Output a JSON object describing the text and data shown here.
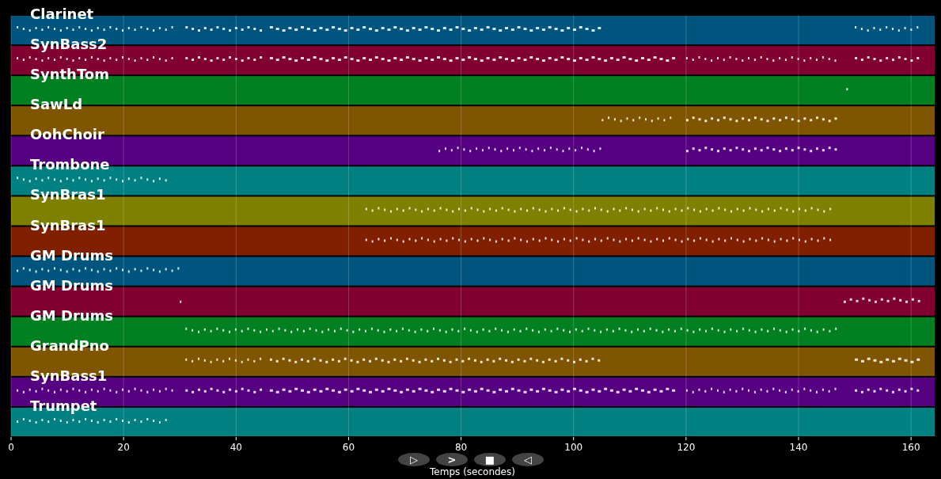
{
  "tracks": [
    {
      "name": "Clarinet",
      "color": "#00557f"
    },
    {
      "name": "SynBass2",
      "color": "#800030"
    },
    {
      "name": "SynthTom",
      "color": "#008020"
    },
    {
      "name": "SawLd",
      "color": "#805500"
    },
    {
      "name": "OohChoir",
      "color": "#550080"
    },
    {
      "name": "Trombone",
      "color": "#008080"
    },
    {
      "name": "SynBras1",
      "color": "#808000"
    },
    {
      "name": "SynBras1",
      "color": "#802000"
    },
    {
      "name": "GM Drums",
      "color": "#00557f"
    },
    {
      "name": "GM Drums",
      "color": "#800030"
    },
    {
      "name": "GM Drums",
      "color": "#008020"
    },
    {
      "name": "GrandPno",
      "color": "#805500"
    },
    {
      "name": "SynBass1",
      "color": "#550080"
    },
    {
      "name": "Trumpet",
      "color": "#008080"
    }
  ],
  "x_axis": {
    "ticks": [
      "0",
      "20",
      "40",
      "60",
      "80",
      "100",
      "120",
      "140",
      "160"
    ],
    "label": "Temps (secondes)"
  },
  "controls": [
    {
      "glyph": "▷"
    },
    {
      "glyph": ">"
    },
    {
      "glyph": "■"
    },
    {
      "glyph": "◁"
    }
  ]
}
